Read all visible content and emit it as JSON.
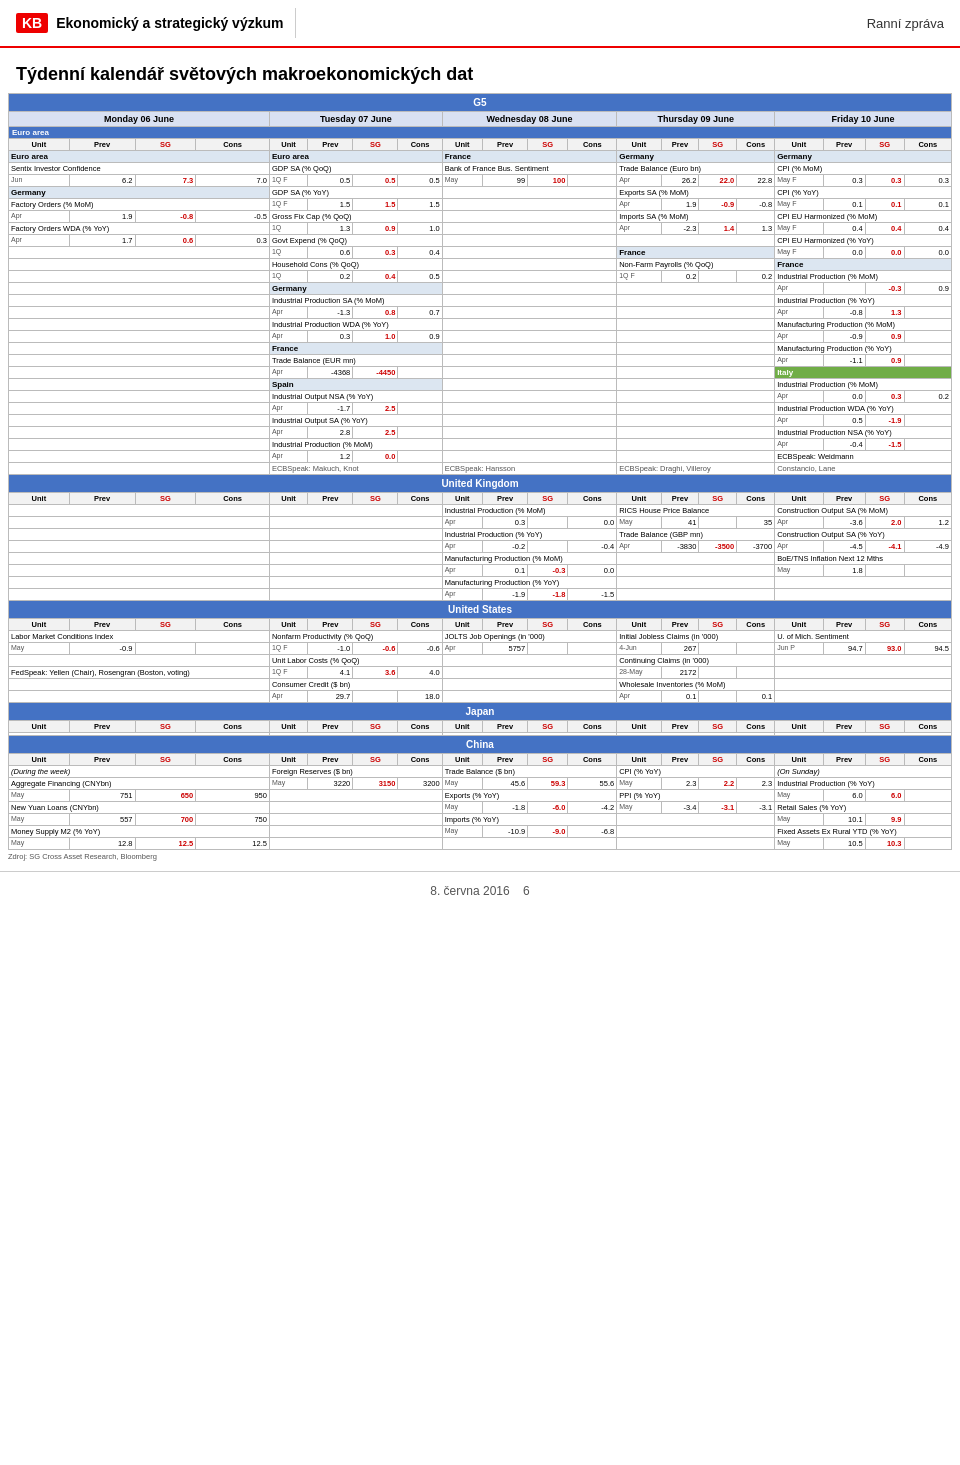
{
  "header": {
    "logo": "KB",
    "org": "Ekonomický a strategický výzkum",
    "report_type": "Ranní zpráva"
  },
  "page_title": "Týdenní kalendář světových makroekonomických dat",
  "footer": {
    "date": "8. června 2016",
    "page": "6",
    "source": "Zdroj: SG Cross Asset Research, Bloomberg"
  },
  "sections": {
    "g5": "G5",
    "uk": "United Kingdom",
    "us": "United States",
    "jp": "Japan",
    "cn": "China"
  },
  "days": [
    "Monday 06 June",
    "Tuesday 07 June",
    "Wednesday 08 June",
    "Thursday 09 June",
    "Friday 10 June"
  ],
  "col_headers": [
    "Unit",
    "Prev",
    "SG",
    "Cons"
  ]
}
